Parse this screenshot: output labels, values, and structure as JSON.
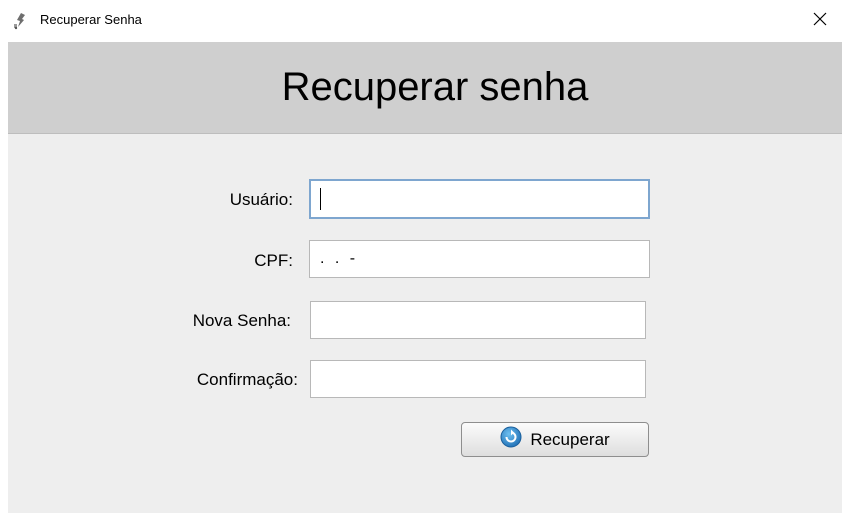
{
  "window": {
    "title": "Recuperar Senha",
    "close_glyph": "✕"
  },
  "header": {
    "title": "Recuperar senha"
  },
  "form": {
    "usuario": {
      "label": "Usuário:",
      "value": ""
    },
    "cpf": {
      "label": "CPF:",
      "value": ". . -"
    },
    "nova_senha": {
      "label": "Nova Senha:",
      "value": ""
    },
    "confirmacao": {
      "label": "Confirmação:",
      "value": ""
    }
  },
  "actions": {
    "recover_label": "Recuperar"
  },
  "icons": {
    "app": "tool-icon",
    "close": "close-icon",
    "recover": "refresh-icon"
  },
  "colors": {
    "header_band": "#cfcfcf",
    "content_bg": "#eeeeee",
    "focus_border": "#7ea6cf",
    "recover_icon": "#2f86c9"
  }
}
